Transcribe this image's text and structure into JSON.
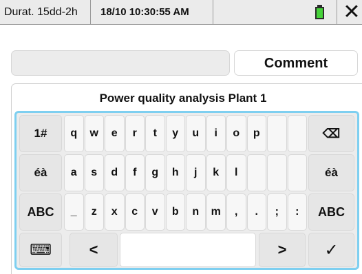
{
  "status_bar": {
    "duration": "Durat. 15dd-2h",
    "datetime": "18/10 10:30:55 AM",
    "battery_icon": "battery-icon",
    "close_icon": "close-icon",
    "close_glyph": "✕"
  },
  "input": {
    "value": "",
    "comment_label": "Comment"
  },
  "panel": {
    "title": "Power quality analysis Plant 1"
  },
  "keyboard": {
    "row1": {
      "left": "1#",
      "keys": [
        "q",
        "w",
        "e",
        "r",
        "t",
        "y",
        "u",
        "i",
        "o",
        "p",
        "",
        ""
      ],
      "right_icon": "backspace-icon",
      "right_glyph": "⌫"
    },
    "row2": {
      "left": "éà",
      "keys": [
        "a",
        "s",
        "d",
        "f",
        "g",
        "h",
        "j",
        "k",
        "l",
        "",
        "",
        ""
      ],
      "right": "éà"
    },
    "row3": {
      "left": "ABC",
      "keys": [
        "_",
        "z",
        "x",
        "c",
        "v",
        "b",
        "n",
        "m",
        ",",
        ".",
        ";",
        ":"
      ],
      "right": "ABC"
    },
    "row4": {
      "keyboard_icon": "keyboard-icon",
      "keyboard_glyph": "⌨",
      "left_arrow": "<",
      "space": "",
      "right_arrow": ">",
      "enter_icon": "check-icon",
      "enter_glyph": "✓"
    }
  }
}
